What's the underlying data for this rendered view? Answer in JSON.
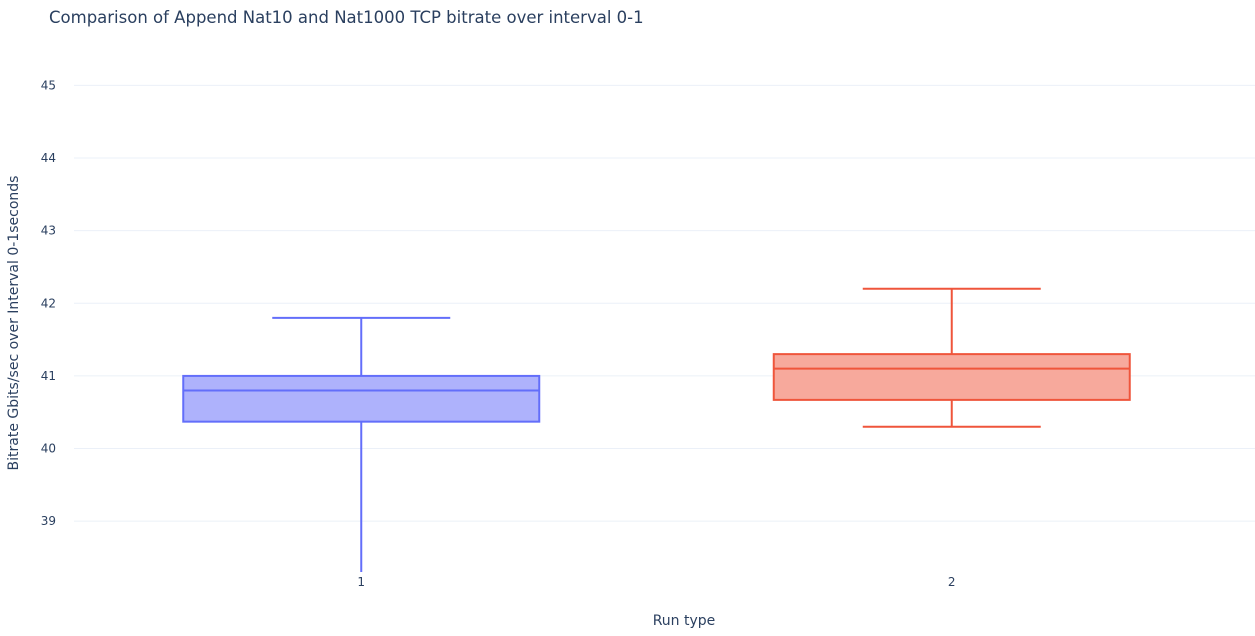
{
  "chart_data": {
    "type": "box",
    "title": "Comparison of Append Nat10 and Nat1000 TCP bitrate over interval 0-1",
    "xlabel": "Run type",
    "ylabel": "Bitrate Gbits/sec over Interval 0-1seconds",
    "categories": [
      "1",
      "2"
    ],
    "ylim": [
      38.3,
      45.35
    ],
    "yticks": [
      "39",
      "40",
      "41",
      "42",
      "43",
      "44",
      "45"
    ],
    "grid": true,
    "series": [
      {
        "category": "1",
        "color": "#636efa",
        "fill": "#aeb2fc",
        "min": 38.3,
        "q1": 40.37,
        "median": 40.8,
        "q3": 41.0,
        "max": 41.8
      },
      {
        "category": "2",
        "color": "#ef553b",
        "fill": "#f7a99c",
        "min": 40.3,
        "q1": 40.67,
        "median": 41.1,
        "q3": 41.3,
        "max": 42.2
      }
    ]
  }
}
